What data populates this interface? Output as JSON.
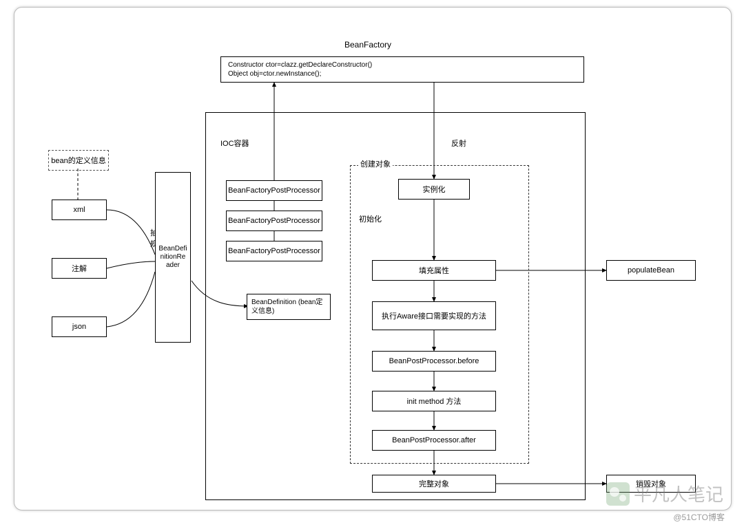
{
  "title": "BeanFactory",
  "constructorBox": "Constructor ctor=clazz.getDeclareConstructor()\nObject obj=ctor.newInstance();",
  "iocLabel": "IOC容器",
  "reflectLabel": "反射",
  "createLabel": "创建对象",
  "initLabel": "初始化",
  "beanDefNote": "bean的定义信息",
  "sources": {
    "xml": "xml",
    "anno": "注解",
    "json": "json"
  },
  "readerLabel": "抽象（定义规范）",
  "readerBox": "BeanDefinitionReader",
  "bfpp1": "BeanFactoryPostProcessor",
  "bfpp2": "BeanFactoryPostProcessor",
  "bfpp3": "BeanFactoryPostProcessor",
  "beanDefBox": "BeanDefinition (bean定义信息)",
  "step_instantiate": "实例化",
  "step_populate": "填充属性",
  "step_aware": "执行Aware接口需要实现的方法",
  "step_bpp_before": "BeanPostProcessor.before",
  "step_init": "init method 方法",
  "step_bpp_after": "BeanPostProcessor.after",
  "step_complete": "完整对象",
  "populateBean": "populateBean",
  "destroy": "销毁对象",
  "watermark": "平凡人笔记",
  "attribution": "@51CTO博客"
}
